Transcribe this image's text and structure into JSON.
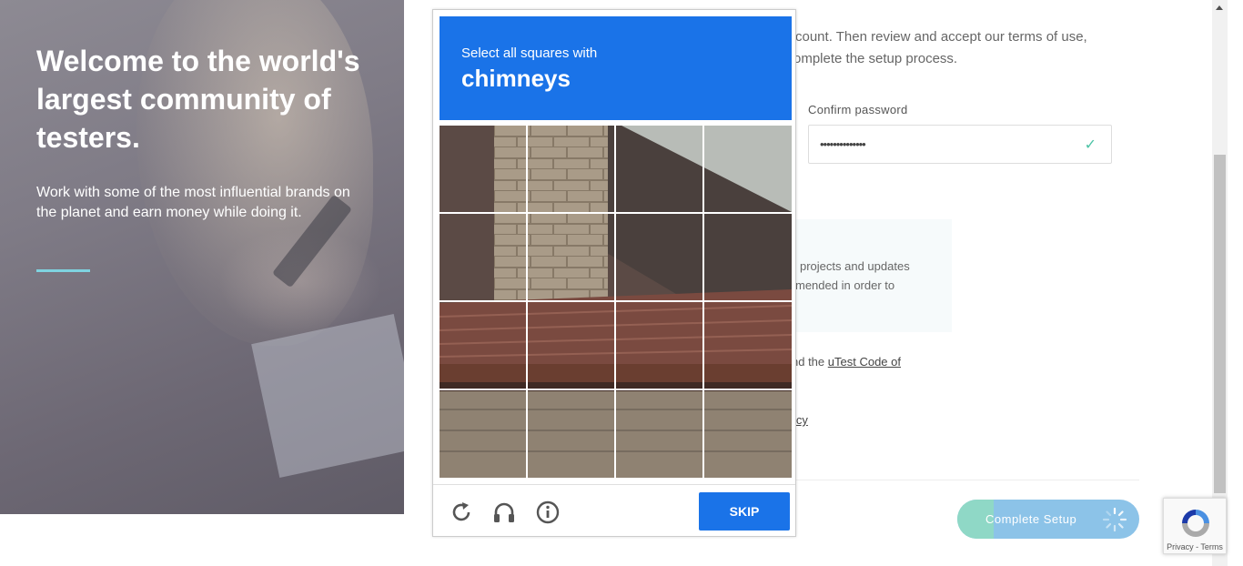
{
  "hero": {
    "heading": "Welcome to the world's largest community of testers.",
    "subtext": "Work with some of the most influential brands on the planet and earn money while doing it."
  },
  "form": {
    "intro_line1": "count. Then review and accept our terms of use,",
    "intro_line2": "omplete the setup process.",
    "confirm_password_label": "Confirm password",
    "confirm_password_value": "••••••••••••••",
    "info_line1": "projects and updates",
    "info_line2": "mended in order to",
    "code_text": "nd the ",
    "code_link": "uTest Code of",
    "policy_link": "icy",
    "complete_button": "Complete Setup",
    "complete_progress": 0.2
  },
  "captcha": {
    "instruction": "Select all squares with",
    "target": "chimneys",
    "skip_label": "SKIP"
  },
  "recaptcha_badge": {
    "terms": "Privacy - Terms"
  },
  "colors": {
    "captcha_blue": "#1a73e8",
    "accent_teal": "#7fd3e0",
    "button_blue": "#8cc3e8",
    "button_progress": "#8fd8c6",
    "check_green": "#4cc3a5"
  }
}
